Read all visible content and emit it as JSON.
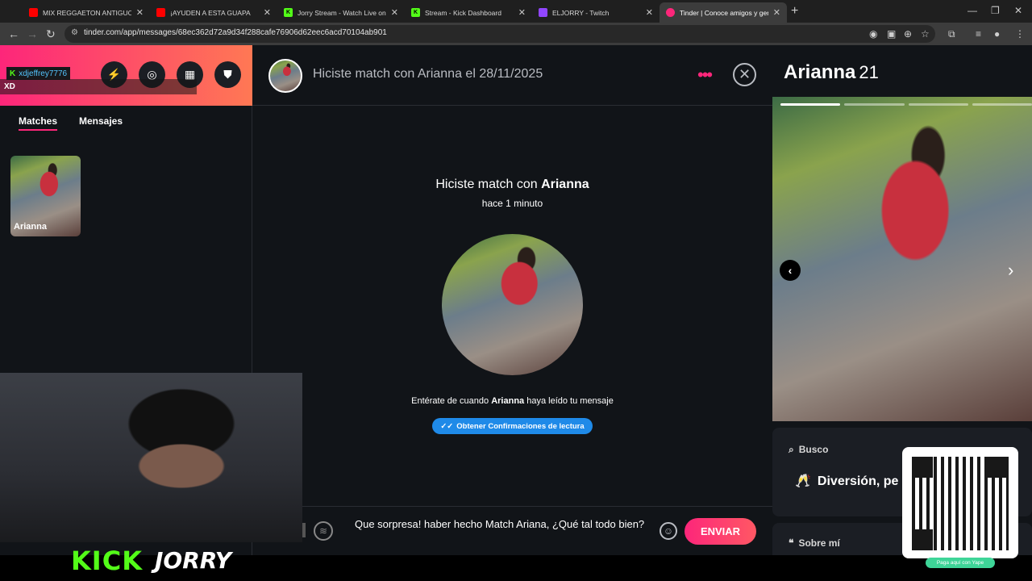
{
  "browser": {
    "tabs": [
      {
        "title": "MIX REGGAETON ANTIGUO RO",
        "favicon": "youtube-icon",
        "color": "#ff0000"
      },
      {
        "title": "¡AYUDEN A ESTA GUAPA",
        "favicon": "youtube-icon",
        "color": "#ff0000"
      },
      {
        "title": "Jorry Stream - Watch Live on Ki",
        "favicon": "kick-icon",
        "color": "#53fc18"
      },
      {
        "title": "Stream - Kick Dashboard",
        "favicon": "kick-icon",
        "color": "#53fc18"
      },
      {
        "title": "ELJORRY - Twitch",
        "favicon": "twitch-icon",
        "color": "#9146ff"
      },
      {
        "title": "Tinder | Conoce amigos y gent",
        "favicon": "tinder-icon",
        "color": "#fd267a"
      }
    ],
    "url": "tinder.com/app/messages/68ec362d72a9d34f288cafe76906d62eec6acd70104ab901"
  },
  "sidebar": {
    "stream_badge": "K",
    "stream_user": "xdjeffrey7776",
    "overlay_text": "XD",
    "tabs": [
      "Matches",
      "Mensajes"
    ],
    "matches": [
      {
        "name": "Arianna"
      }
    ]
  },
  "chat": {
    "header_title": "Hiciste match con Arianna el 28/11/2025",
    "match_prefix": "Hiciste match con ",
    "match_name": "Arianna",
    "match_time": "hace 1 minuto",
    "read_prefix": "Entérate de cuando ",
    "read_name": "Arianna",
    "read_suffix": " haya leído tu mensaje",
    "read_button": "Obtener Confirmaciones de lectura",
    "message": "Que sorpresa! haber hecho Match Ariana, ¿Qué tal todo bien?",
    "send_label": "ENVIAR"
  },
  "profile": {
    "name": "Arianna",
    "age": "21",
    "photo_count": 4,
    "active_photo": 1,
    "looking_label": "Busco",
    "looking_value": "Diversión, pe",
    "about_label": "Sobre mí"
  },
  "stream": {
    "kick_label": "KICK",
    "streamer": "JORRY",
    "qr_caption": "Paga aquí con Yape"
  },
  "colors": {
    "accent": "#fd267a",
    "kick_green": "#53fc18",
    "read_blue": "#1f8ae8"
  }
}
